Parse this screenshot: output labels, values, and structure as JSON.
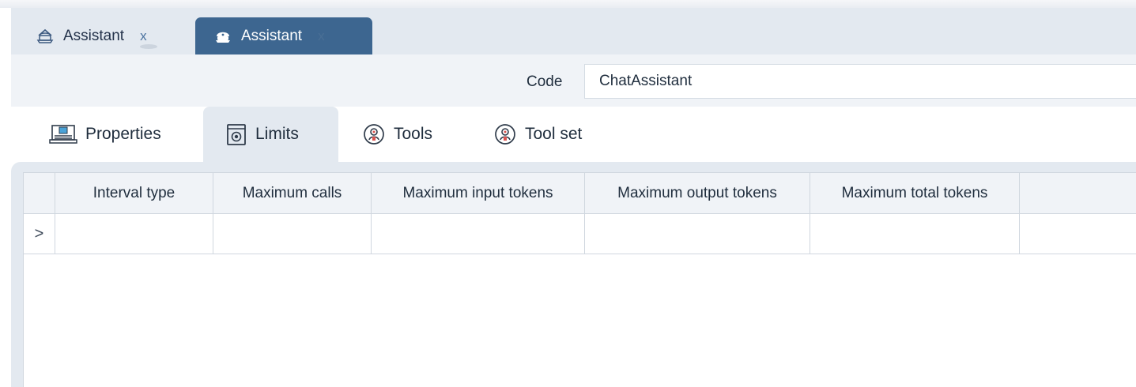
{
  "doc_tabs": [
    {
      "label": "Assistant",
      "close": "x",
      "icon": "assistant-outline-icon",
      "active": false
    },
    {
      "label": "Assistant",
      "close": "x",
      "icon": "assistant-filled-icon",
      "active": true
    }
  ],
  "code": {
    "label": "Code",
    "value": "ChatAssistant"
  },
  "section_tabs": [
    {
      "label": "Properties",
      "icon": "properties-icon",
      "selected": false
    },
    {
      "label": "Limits",
      "icon": "limits-icon",
      "selected": true
    },
    {
      "label": "Tools",
      "icon": "tools-icon",
      "selected": false
    },
    {
      "label": "Tool set",
      "icon": "tool-set-icon",
      "selected": false
    }
  ],
  "grid": {
    "columns": [
      "",
      "Interval type",
      "Maximum calls",
      "Maximum input tokens",
      "Maximum output tokens",
      "Maximum total tokens",
      ""
    ],
    "rows": [
      {
        "selector": ">",
        "cells": [
          "",
          "",
          "",
          "",
          "",
          ""
        ]
      }
    ]
  },
  "colors": {
    "active_tab": "#3d6690",
    "strip_bg": "#e3e9f0",
    "panel_bg": "#f0f3f7",
    "grid_line": "#d0d7df"
  }
}
